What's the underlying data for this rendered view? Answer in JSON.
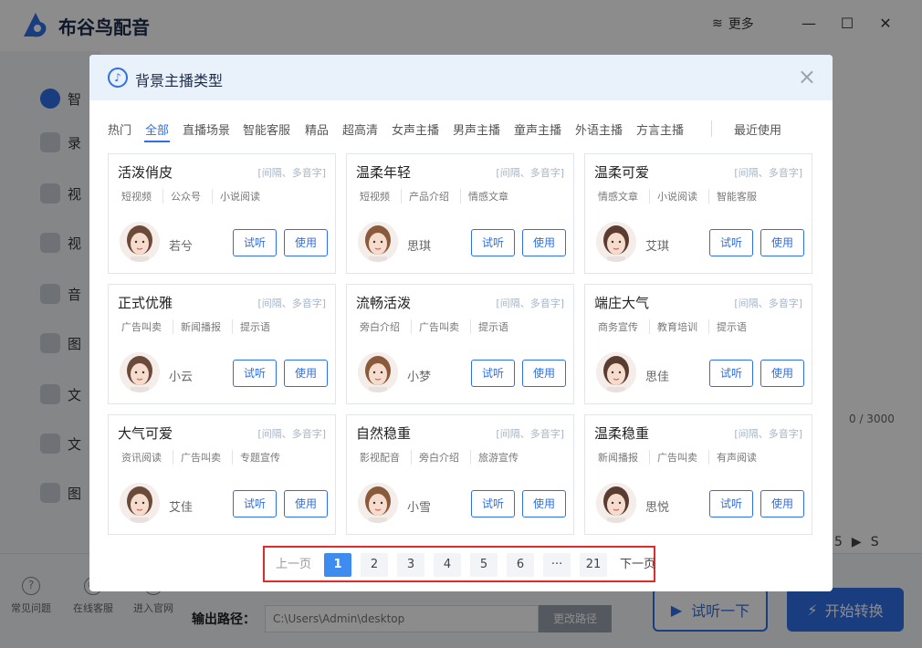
{
  "app": {
    "title": "布谷鸟配音",
    "more_label": "更多",
    "minimize": "—",
    "maximize": "☐",
    "close": "✕"
  },
  "sidebar": {
    "items": [
      {
        "label": "智"
      },
      {
        "label": "录"
      },
      {
        "label": "视"
      },
      {
        "label": "视"
      },
      {
        "label": "音"
      },
      {
        "label": "图"
      },
      {
        "label": "文"
      },
      {
        "label": "文"
      },
      {
        "label": "图"
      }
    ]
  },
  "background": {
    "counter": "0 / 3000",
    "mini_ctrl": [
      "5",
      "▶",
      "S"
    ],
    "bottom_links": [
      "常见问题",
      "在线客服",
      "进入官网"
    ],
    "output_label": "输出路径：",
    "output_path": "C:\\Users\\Admin\\desktop",
    "change_path": "更改路径",
    "listen_button": "试听一下",
    "convert_button": "开始转换"
  },
  "modal": {
    "title": "背景主播类型",
    "tabs": [
      "热门",
      "全部",
      "直播场景",
      "智能客服",
      "精品",
      "超高清",
      "女声主播",
      "男声主播",
      "童声主播",
      "外语主播",
      "方言主播",
      "最近使用"
    ],
    "active_tab": "全部",
    "listen_label": "试听",
    "use_label": "使用",
    "cards": [
      {
        "name": "活泼俏皮",
        "hint": "[间隔、多音字]",
        "tags": [
          "短视频",
          "公众号",
          "小说阅读"
        ],
        "voice": "若兮"
      },
      {
        "name": "温柔年轻",
        "hint": "[间隔、多音字]",
        "tags": [
          "短视频",
          "产品介绍",
          "情感文章"
        ],
        "voice": "思琪"
      },
      {
        "name": "温柔可爱",
        "hint": "[间隔、多音字]",
        "tags": [
          "情感文章",
          "小说阅读",
          "智能客服"
        ],
        "voice": "艾琪"
      },
      {
        "name": "正式优雅",
        "hint": "[间隔、多音字]",
        "tags": [
          "广告叫卖",
          "新闻播报",
          "提示语"
        ],
        "voice": "小云"
      },
      {
        "name": "流畅活泼",
        "hint": "[间隔、多音字]",
        "tags": [
          "旁白介绍",
          "广告叫卖",
          "提示语"
        ],
        "voice": "小梦"
      },
      {
        "name": "端庄大气",
        "hint": "[间隔、多音字]",
        "tags": [
          "商务宣传",
          "教育培训",
          "提示语"
        ],
        "voice": "思佳"
      },
      {
        "name": "大气可爱",
        "hint": "[间隔、多音字]",
        "tags": [
          "资讯阅读",
          "广告叫卖",
          "专题宣传"
        ],
        "voice": "艾佳"
      },
      {
        "name": "自然稳重",
        "hint": "[间隔、多音字]",
        "tags": [
          "影视配音",
          "旁白介绍",
          "旅游宣传"
        ],
        "voice": "小雪"
      },
      {
        "name": "温柔稳重",
        "hint": "[间隔、多音字]",
        "tags": [
          "新闻播报",
          "广告叫卖",
          "有声阅读"
        ],
        "voice": "思悦"
      }
    ],
    "pager": {
      "prev": "上一页",
      "pages": [
        "1",
        "2",
        "3",
        "4",
        "5",
        "6",
        "···",
        "21"
      ],
      "current": "1",
      "next": "下一页"
    }
  },
  "colors": {
    "accent": "#2f6fe5",
    "highlight_box": "#e12a2a"
  }
}
